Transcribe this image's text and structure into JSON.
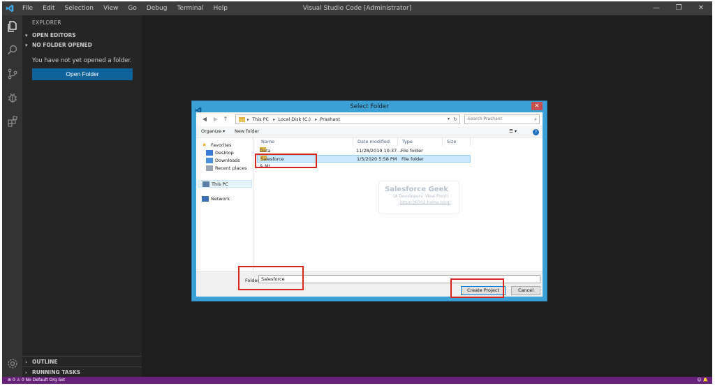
{
  "window": {
    "title": "Visual Studio Code [Administrator]",
    "menu": [
      "File",
      "Edit",
      "Selection",
      "View",
      "Go",
      "Debug",
      "Terminal",
      "Help"
    ],
    "controls": [
      "—",
      "❐",
      "✕"
    ]
  },
  "sidebar": {
    "title": "EXPLORER",
    "sections": {
      "open_editors": "OPEN EDITORS",
      "no_folder": "NO FOLDER OPENED",
      "outline": "OUTLINE",
      "running_tasks": "RUNNING TASKS"
    },
    "message": "You have not yet opened a folder.",
    "open_folder_label": "Open Folder"
  },
  "statusbar": {
    "left": "⊗ 0  ⚠ 0   No Default Org Set",
    "right": "☺ 🔔"
  },
  "dialog": {
    "title": "Select Folder",
    "address": [
      "This PC",
      "Local Disk (C:)",
      "Prashant"
    ],
    "search_placeholder": "Search Prashant",
    "toolbar": {
      "organize": "Organize ▾",
      "new_folder": "New folder",
      "view": "☰ ▾",
      "help": "?"
    },
    "nav": {
      "favorites": "Favorites",
      "desktop": "Desktop",
      "downloads": "Downloads",
      "recent": "Recent places",
      "this_pc": "This PC",
      "network": "Network"
    },
    "columns": {
      "name": "Name",
      "date": "Date modified",
      "type": "Type",
      "size": "Size"
    },
    "rows": [
      {
        "name": "Data Science & ML",
        "date": "11/28/2019 10:37 ...",
        "type": "File folder"
      },
      {
        "name": "Salesforce",
        "date": "1/5/2020 5:58 PM",
        "type": "File folder"
      }
    ],
    "watermark": {
      "title": "Salesforce Geek",
      "subtitle": "(A Developers' View Point)",
      "url": "https://6302.home.blog/"
    },
    "folder_label": "Folder:",
    "folder_value": "Salesforce",
    "create_label": "Create Project",
    "cancel_label": "Cancel"
  },
  "colors": {
    "accent": "#0e639c",
    "statusbar": "#68217a",
    "dialog_frame": "#3aa0d6",
    "highlight": "#d9261c"
  }
}
